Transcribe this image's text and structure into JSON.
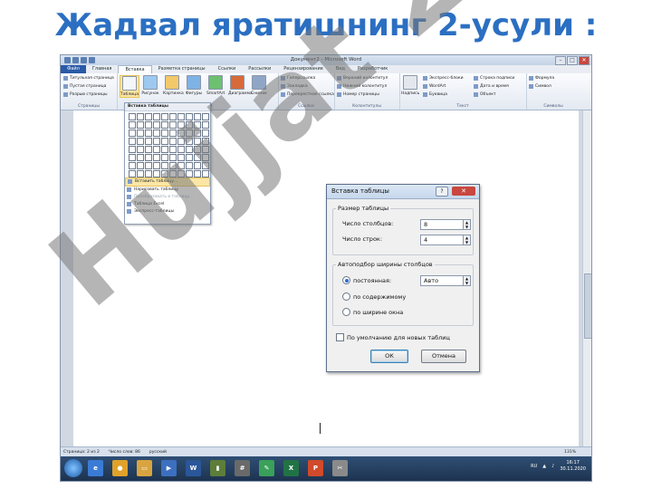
{
  "slide": {
    "title": "Жадвал яратишнинг 2-усули :"
  },
  "app": {
    "doc_title": "Документ2 - Microsoft Word",
    "tabs": [
      {
        "label": "Файл",
        "state": "file"
      },
      {
        "label": "Главная",
        "state": ""
      },
      {
        "label": "Вставка",
        "state": "active"
      },
      {
        "label": "Разметка страницы",
        "state": ""
      },
      {
        "label": "Ссылки",
        "state": ""
      },
      {
        "label": "Рассылки",
        "state": ""
      },
      {
        "label": "Рецензирование",
        "state": ""
      },
      {
        "label": "Вид",
        "state": ""
      },
      {
        "label": "Разработчик",
        "state": ""
      }
    ],
    "ribbon": {
      "pages_items": [
        "Титульная страница",
        "Пустая страница",
        "Разрыв страницы"
      ],
      "pages_label": "Страницы",
      "illus_buttons": [
        "Таблица",
        "Рисунок",
        "Картинка",
        "Фигуры",
        "SmartArt",
        "Диаграмма",
        "Снимок"
      ],
      "illus_label": "Иллюстрации",
      "links_items": [
        "Гиперссылка",
        "Закладка",
        "Перекрестная ссылка"
      ],
      "links_label": "Ссылки",
      "hf_items": [
        "Верхний колонтитул",
        "Нижний колонтитул",
        "Номер страницы"
      ],
      "hf_label": "Колонтитулы",
      "text_items": [
        "Экспресс-блоки",
        "WordArt",
        "Буквица",
        "Строка подписи",
        "Дата и время",
        "Объект"
      ],
      "text_big": "Надпись",
      "text_label": "Текст",
      "sym_items": [
        "Формула",
        "Символ"
      ],
      "sym_label": "Символы"
    },
    "dropdown": {
      "header": "Вставка таблицы",
      "items": [
        {
          "label": "Вставить таблицу...",
          "state": "hl"
        },
        {
          "label": "Нарисовать таблицу",
          "state": ""
        },
        {
          "label": "Преобразовать в таблицу...",
          "state": "dis"
        },
        {
          "label": "Таблица Excel",
          "state": ""
        },
        {
          "label": "Экспресс-таблицы",
          "state": ""
        }
      ]
    },
    "dialog": {
      "title": "Вставка таблицы",
      "help": "?",
      "close": "✕",
      "size_group": "Размер таблицы",
      "cols_label": "Число столбцов:",
      "cols_value": "8",
      "rows_label": "Число строк:",
      "rows_value": "4",
      "autofit_group": "Автоподбор ширины столбцов",
      "fixed_label": "постоянная:",
      "fixed_value": "Авто",
      "content_label": "по содержимому",
      "window_label": "по ширине окна",
      "default_label": "По умолчанию для новых таблиц",
      "ok": "ОК",
      "cancel": "Отмена"
    },
    "status": {
      "page": "Страница: 2 из 2",
      "words": "Число слов: 86",
      "lang": "русский",
      "zoom": "131%"
    },
    "taskbar": {
      "lang": "RU",
      "time": "16:17",
      "date": "30.11.2020"
    }
  },
  "watermark": {
    "text": "Hujjat 24"
  }
}
